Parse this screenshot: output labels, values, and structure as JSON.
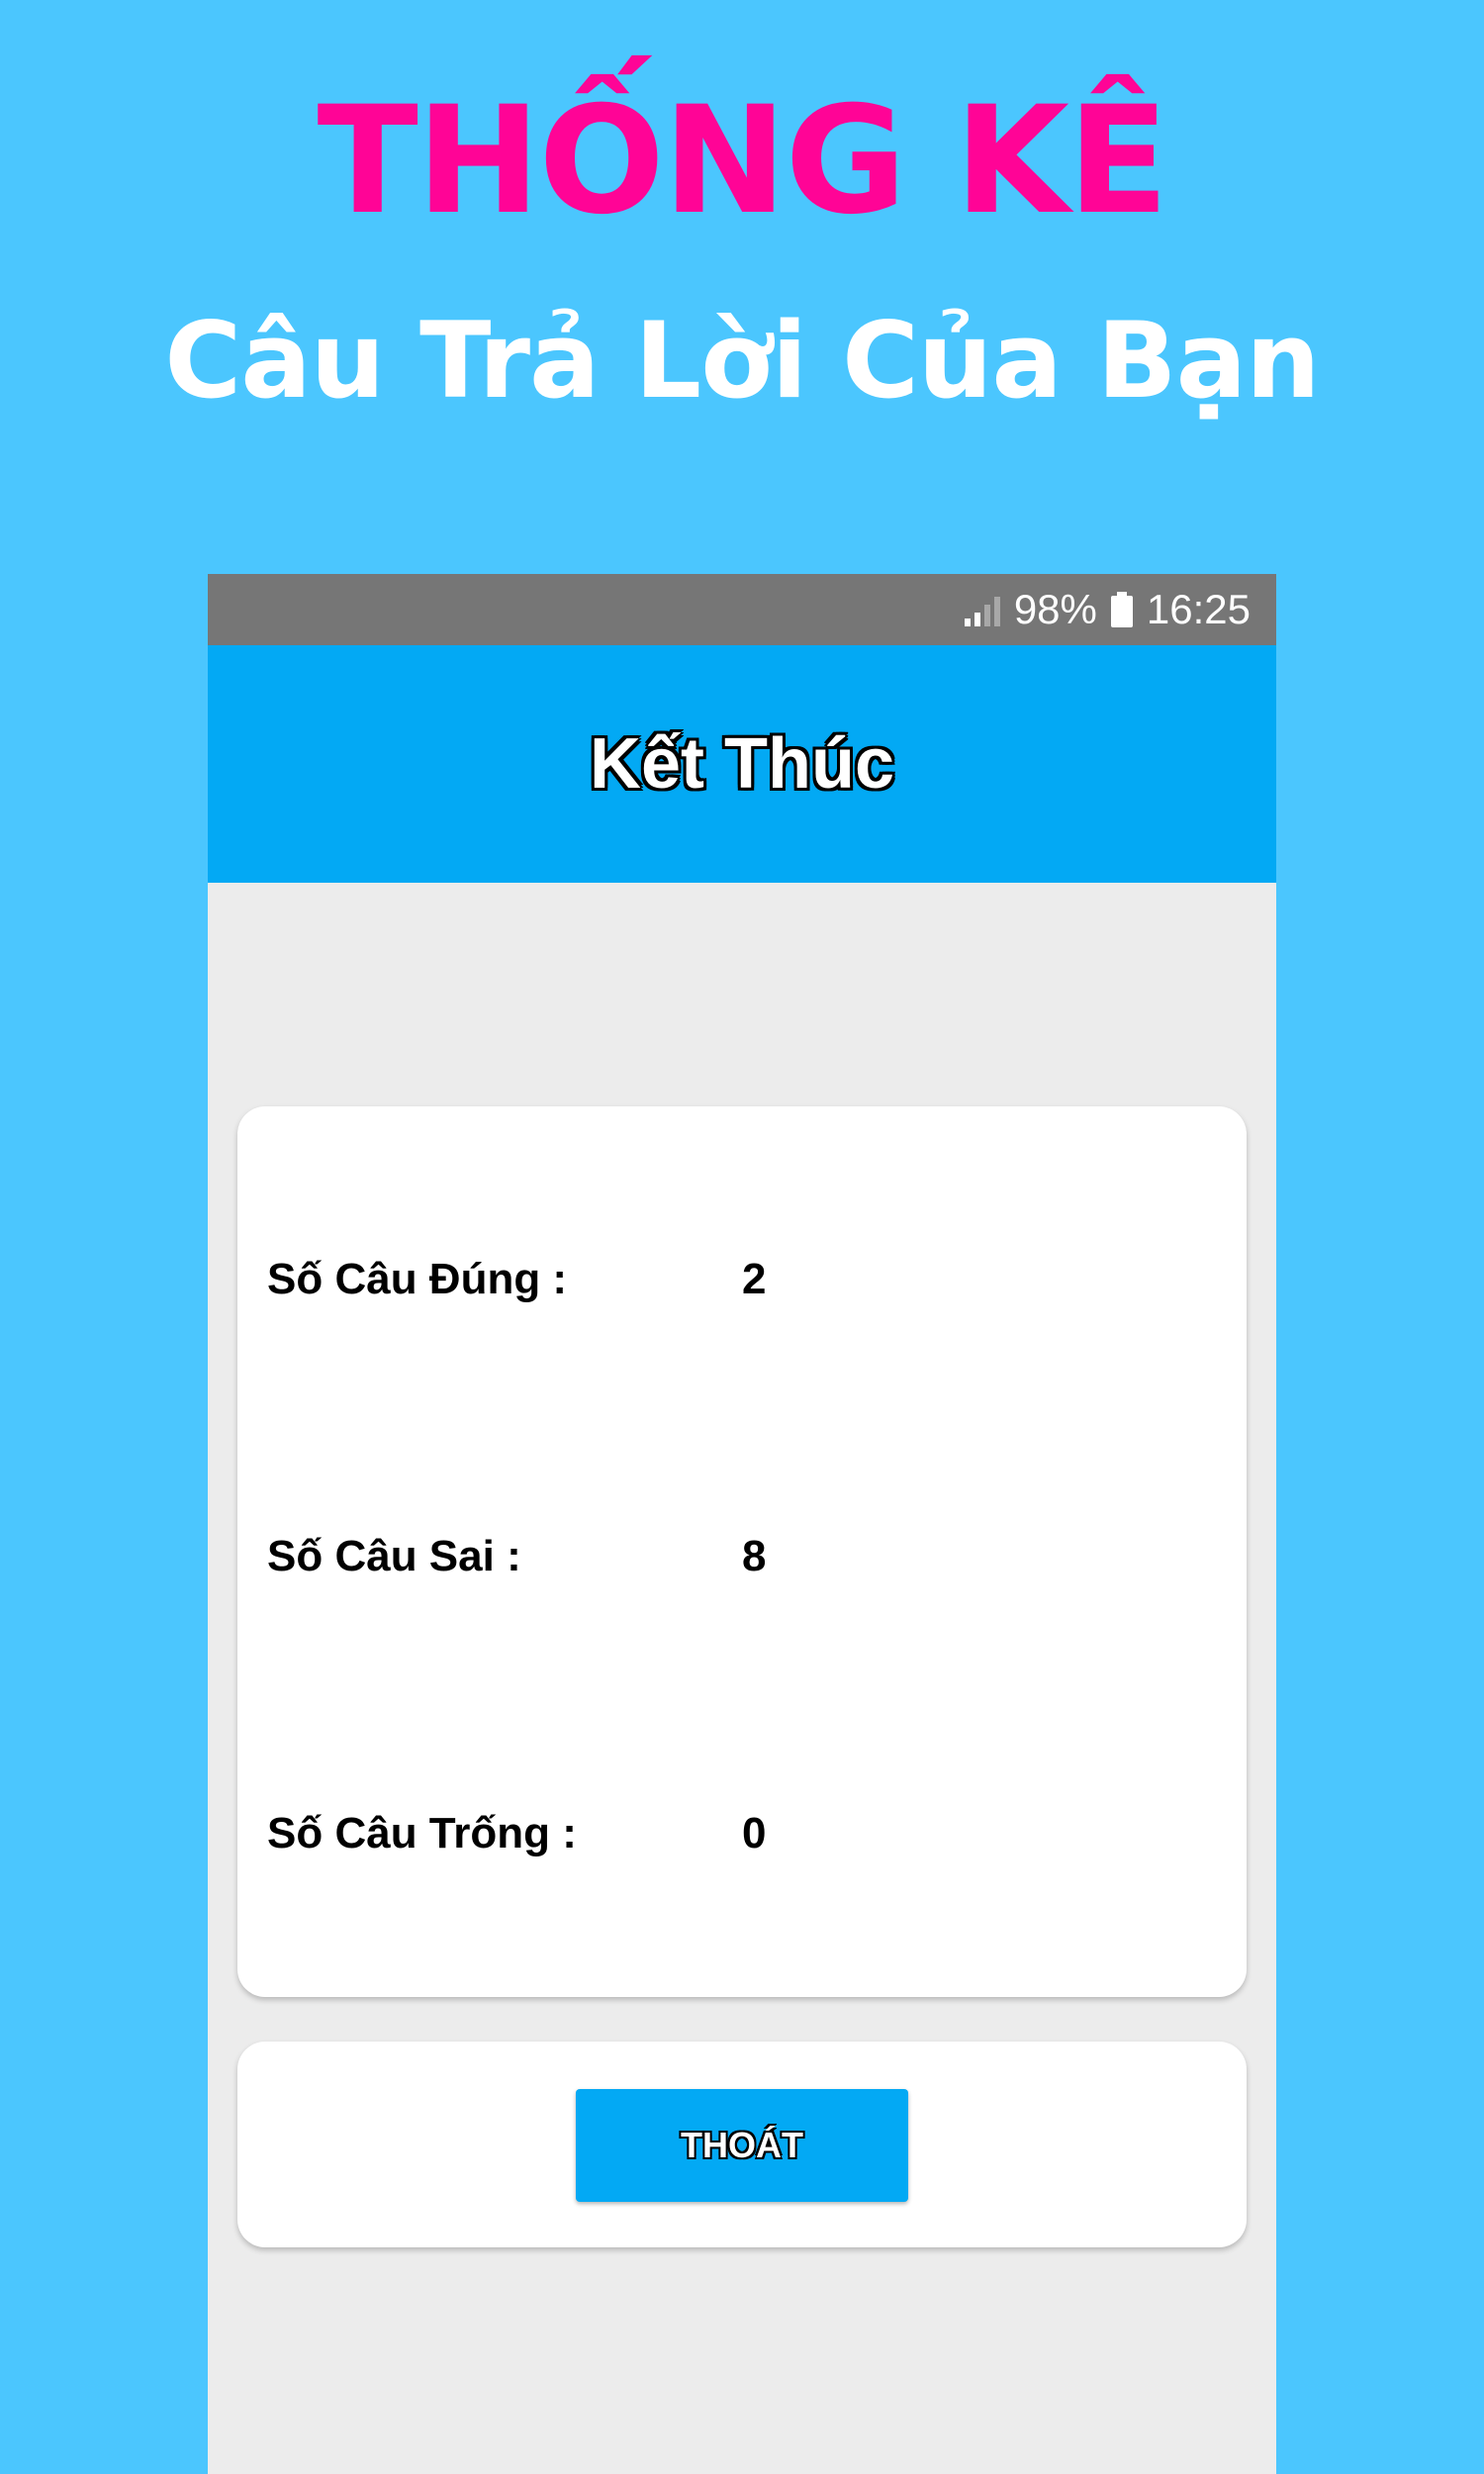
{
  "promo": {
    "title": "THỐNG KÊ",
    "subtitle": "Câu Trả Lời Của Bạn"
  },
  "status_bar": {
    "battery": "98%",
    "time": "16:25",
    "icons": [
      "signal-icon",
      "battery-icon"
    ]
  },
  "app_bar": {
    "title": "Kết Thúc"
  },
  "stats": {
    "rows": [
      {
        "label": "Số Câu Đúng :",
        "value": "2"
      },
      {
        "label": "Số Câu Sai :",
        "value": "8"
      },
      {
        "label": "Số Câu Trống :",
        "value": "0"
      }
    ]
  },
  "actions": {
    "exit_label": "THOÁT"
  },
  "colors": {
    "background": "#4bc6fe",
    "promo_title": "#ff0496",
    "app_bar": "#03a9f4",
    "status_bar": "#767676",
    "screen_background": "#ececec"
  }
}
